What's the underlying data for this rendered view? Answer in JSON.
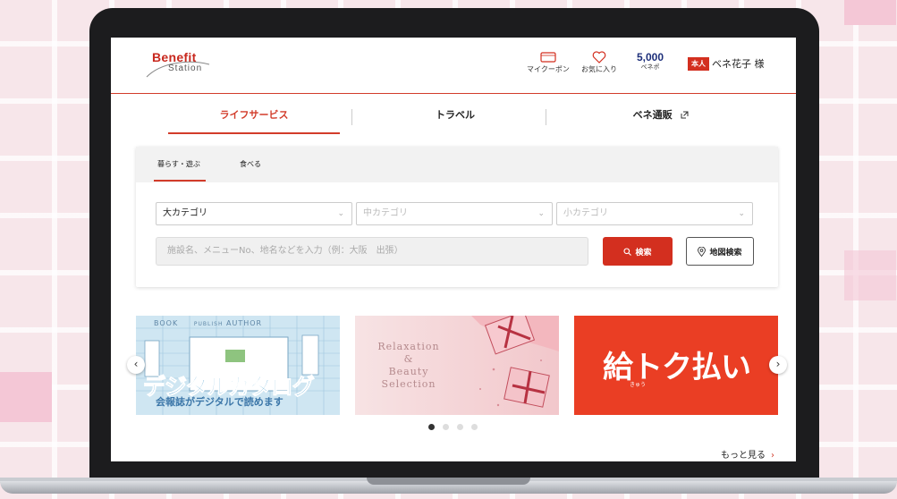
{
  "header": {
    "logo_top": "Benefit",
    "logo_bottom": "Station",
    "coupon_label": "マイクーポン",
    "favorites_label": "お気に入り",
    "points_value": "5,000",
    "points_label": "ベネポ",
    "role_badge": "本人",
    "user_name": "ベネ花子 様"
  },
  "main_tabs": [
    {
      "label": "ライフサービス"
    },
    {
      "label": "トラベル"
    },
    {
      "label": "ベネ通販"
    }
  ],
  "search": {
    "sub_tabs": [
      {
        "label": "暮らす・遊ぶ"
      },
      {
        "label": "食べる"
      }
    ],
    "category_large": "大カテゴリ",
    "category_medium": "中カテゴリ",
    "category_small": "小カテゴリ",
    "placeholder": "施設名、メニューNo、地名などを入力（例：大阪　出張）",
    "search_button": "検索",
    "map_search_button": "地図検索"
  },
  "banners": [
    {
      "top_words": [
        "BOOK",
        "PUBLISH",
        "AUTHOR"
      ],
      "title": "デジタルカタログ",
      "subtitle": "会報誌がデジタルで読めます"
    },
    {
      "line1": "Relaxation",
      "line2": "&",
      "line3": "Beauty",
      "line4": "Selection"
    },
    {
      "title": "給トク払い",
      "ruby": "きゅう"
    }
  ],
  "carousel": {
    "dots": 4,
    "active": 0
  },
  "more_link": "もっと見る",
  "colors": {
    "accent": "#d32f1f",
    "navy": "#1d2f7a"
  }
}
